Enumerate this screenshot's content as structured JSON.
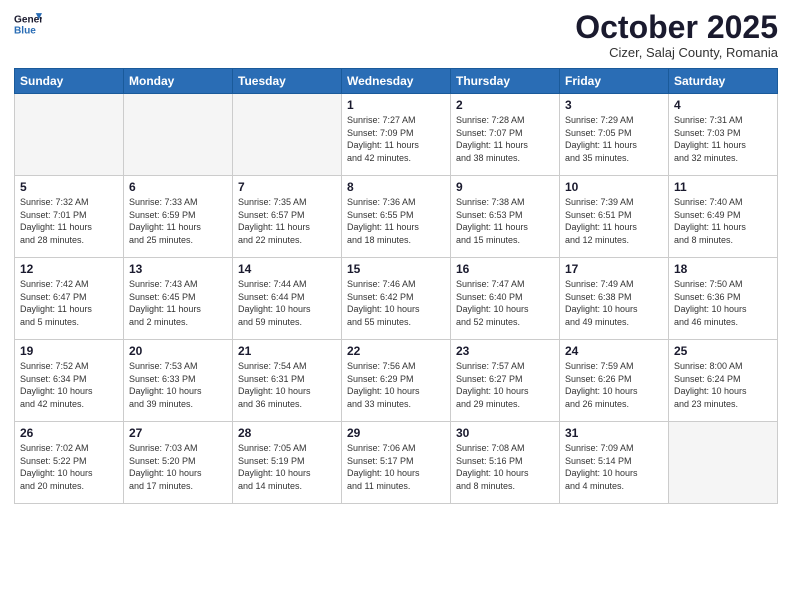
{
  "header": {
    "logo_line1": "General",
    "logo_line2": "Blue",
    "month": "October 2025",
    "location": "Cizer, Salaj County, Romania"
  },
  "weekdays": [
    "Sunday",
    "Monday",
    "Tuesday",
    "Wednesday",
    "Thursday",
    "Friday",
    "Saturday"
  ],
  "weeks": [
    [
      {
        "day": "",
        "info": ""
      },
      {
        "day": "",
        "info": ""
      },
      {
        "day": "",
        "info": ""
      },
      {
        "day": "1",
        "info": "Sunrise: 7:27 AM\nSunset: 7:09 PM\nDaylight: 11 hours\nand 42 minutes."
      },
      {
        "day": "2",
        "info": "Sunrise: 7:28 AM\nSunset: 7:07 PM\nDaylight: 11 hours\nand 38 minutes."
      },
      {
        "day": "3",
        "info": "Sunrise: 7:29 AM\nSunset: 7:05 PM\nDaylight: 11 hours\nand 35 minutes."
      },
      {
        "day": "4",
        "info": "Sunrise: 7:31 AM\nSunset: 7:03 PM\nDaylight: 11 hours\nand 32 minutes."
      }
    ],
    [
      {
        "day": "5",
        "info": "Sunrise: 7:32 AM\nSunset: 7:01 PM\nDaylight: 11 hours\nand 28 minutes."
      },
      {
        "day": "6",
        "info": "Sunrise: 7:33 AM\nSunset: 6:59 PM\nDaylight: 11 hours\nand 25 minutes."
      },
      {
        "day": "7",
        "info": "Sunrise: 7:35 AM\nSunset: 6:57 PM\nDaylight: 11 hours\nand 22 minutes."
      },
      {
        "day": "8",
        "info": "Sunrise: 7:36 AM\nSunset: 6:55 PM\nDaylight: 11 hours\nand 18 minutes."
      },
      {
        "day": "9",
        "info": "Sunrise: 7:38 AM\nSunset: 6:53 PM\nDaylight: 11 hours\nand 15 minutes."
      },
      {
        "day": "10",
        "info": "Sunrise: 7:39 AM\nSunset: 6:51 PM\nDaylight: 11 hours\nand 12 minutes."
      },
      {
        "day": "11",
        "info": "Sunrise: 7:40 AM\nSunset: 6:49 PM\nDaylight: 11 hours\nand 8 minutes."
      }
    ],
    [
      {
        "day": "12",
        "info": "Sunrise: 7:42 AM\nSunset: 6:47 PM\nDaylight: 11 hours\nand 5 minutes."
      },
      {
        "day": "13",
        "info": "Sunrise: 7:43 AM\nSunset: 6:45 PM\nDaylight: 11 hours\nand 2 minutes."
      },
      {
        "day": "14",
        "info": "Sunrise: 7:44 AM\nSunset: 6:44 PM\nDaylight: 10 hours\nand 59 minutes."
      },
      {
        "day": "15",
        "info": "Sunrise: 7:46 AM\nSunset: 6:42 PM\nDaylight: 10 hours\nand 55 minutes."
      },
      {
        "day": "16",
        "info": "Sunrise: 7:47 AM\nSunset: 6:40 PM\nDaylight: 10 hours\nand 52 minutes."
      },
      {
        "day": "17",
        "info": "Sunrise: 7:49 AM\nSunset: 6:38 PM\nDaylight: 10 hours\nand 49 minutes."
      },
      {
        "day": "18",
        "info": "Sunrise: 7:50 AM\nSunset: 6:36 PM\nDaylight: 10 hours\nand 46 minutes."
      }
    ],
    [
      {
        "day": "19",
        "info": "Sunrise: 7:52 AM\nSunset: 6:34 PM\nDaylight: 10 hours\nand 42 minutes."
      },
      {
        "day": "20",
        "info": "Sunrise: 7:53 AM\nSunset: 6:33 PM\nDaylight: 10 hours\nand 39 minutes."
      },
      {
        "day": "21",
        "info": "Sunrise: 7:54 AM\nSunset: 6:31 PM\nDaylight: 10 hours\nand 36 minutes."
      },
      {
        "day": "22",
        "info": "Sunrise: 7:56 AM\nSunset: 6:29 PM\nDaylight: 10 hours\nand 33 minutes."
      },
      {
        "day": "23",
        "info": "Sunrise: 7:57 AM\nSunset: 6:27 PM\nDaylight: 10 hours\nand 29 minutes."
      },
      {
        "day": "24",
        "info": "Sunrise: 7:59 AM\nSunset: 6:26 PM\nDaylight: 10 hours\nand 26 minutes."
      },
      {
        "day": "25",
        "info": "Sunrise: 8:00 AM\nSunset: 6:24 PM\nDaylight: 10 hours\nand 23 minutes."
      }
    ],
    [
      {
        "day": "26",
        "info": "Sunrise: 7:02 AM\nSunset: 5:22 PM\nDaylight: 10 hours\nand 20 minutes."
      },
      {
        "day": "27",
        "info": "Sunrise: 7:03 AM\nSunset: 5:20 PM\nDaylight: 10 hours\nand 17 minutes."
      },
      {
        "day": "28",
        "info": "Sunrise: 7:05 AM\nSunset: 5:19 PM\nDaylight: 10 hours\nand 14 minutes."
      },
      {
        "day": "29",
        "info": "Sunrise: 7:06 AM\nSunset: 5:17 PM\nDaylight: 10 hours\nand 11 minutes."
      },
      {
        "day": "30",
        "info": "Sunrise: 7:08 AM\nSunset: 5:16 PM\nDaylight: 10 hours\nand 8 minutes."
      },
      {
        "day": "31",
        "info": "Sunrise: 7:09 AM\nSunset: 5:14 PM\nDaylight: 10 hours\nand 4 minutes."
      },
      {
        "day": "",
        "info": ""
      }
    ]
  ]
}
